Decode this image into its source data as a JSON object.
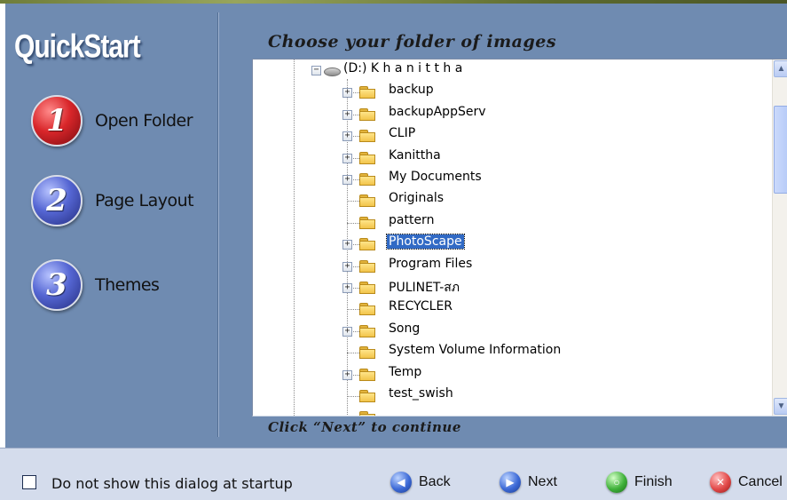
{
  "sidebar": {
    "title": "QuickStart",
    "steps": [
      {
        "number": "1",
        "label": "Open Folder",
        "color": "red"
      },
      {
        "number": "2",
        "label": "Page Layout",
        "color": "blue"
      },
      {
        "number": "3",
        "label": "Themes",
        "color": "blue"
      }
    ]
  },
  "main": {
    "heading": "Choose your folder of images",
    "hint": "Click “Next” to continue"
  },
  "tree": {
    "root": {
      "label": "(D:) K h a n i t t h a",
      "icon": "drive-icon",
      "expanded": true
    },
    "items": [
      {
        "label": "backup",
        "expandable": true,
        "selected": false
      },
      {
        "label": "backupAppServ",
        "expandable": true,
        "selected": false
      },
      {
        "label": "CLIP",
        "expandable": true,
        "selected": false
      },
      {
        "label": "Kanittha",
        "expandable": true,
        "selected": false
      },
      {
        "label": "My Documents",
        "expandable": true,
        "selected": false
      },
      {
        "label": "Originals",
        "expandable": false,
        "selected": false
      },
      {
        "label": "pattern",
        "expandable": false,
        "selected": false
      },
      {
        "label": "PhotoScape",
        "expandable": true,
        "selected": true
      },
      {
        "label": "Program Files",
        "expandable": true,
        "selected": false
      },
      {
        "label": "PULINET-สภ",
        "expandable": true,
        "selected": false
      },
      {
        "label": "RECYCLER",
        "expandable": false,
        "selected": false
      },
      {
        "label": "Song",
        "expandable": true,
        "selected": false
      },
      {
        "label": "System Volume Information",
        "expandable": false,
        "selected": false
      },
      {
        "label": "Temp",
        "expandable": true,
        "selected": false
      },
      {
        "label": "test_swish",
        "expandable": false,
        "selected": false
      }
    ]
  },
  "footer": {
    "checkbox_label": "Do not show this dialog at startup",
    "checkbox_checked": false,
    "buttons": {
      "back": "Back",
      "next": "Next",
      "finish": "Finish",
      "cancel": "Cancel"
    }
  },
  "colors": {
    "panel_bg": "#6f8bb1",
    "footer_bg": "#d4dcec",
    "selection": "#316ac5",
    "step1": "#d9262a",
    "step_other": "#5566d3"
  }
}
